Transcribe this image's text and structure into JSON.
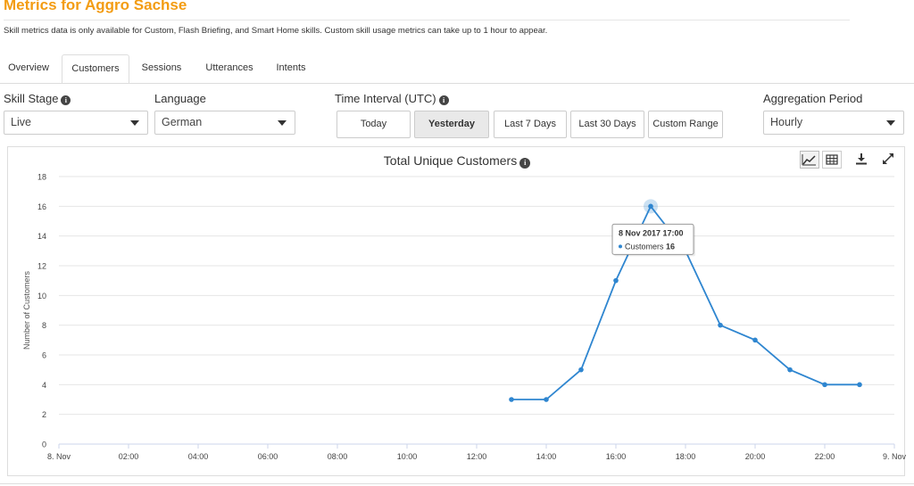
{
  "header": {
    "title": "Metrics for Aggro Sachse",
    "notice": "Skill metrics data is only available for Custom, Flash Briefing, and Smart Home skills. Custom skill usage metrics can take up to 1 hour to appear."
  },
  "tabs": [
    {
      "label": "Overview",
      "active": false
    },
    {
      "label": "Customers",
      "active": true
    },
    {
      "label": "Sessions",
      "active": false
    },
    {
      "label": "Utterances",
      "active": false
    },
    {
      "label": "Intents",
      "active": false
    }
  ],
  "controls": {
    "skill_stage": {
      "label": "Skill Stage",
      "value": "Live",
      "icon": "info-icon"
    },
    "language": {
      "label": "Language",
      "value": "German"
    },
    "time_interval": {
      "label": "Time Interval (UTC)",
      "icon": "info-icon",
      "options": [
        "Today",
        "Yesterday",
        "Last 7 Days",
        "Last 30 Days",
        "Custom Range"
      ],
      "selected": "Yesterday"
    },
    "aggregation_period": {
      "label": "Aggregation Period",
      "value": "Hourly"
    }
  },
  "chart_toolbar": {
    "icons": [
      "line-chart-icon",
      "table-icon",
      "download-icon",
      "expand-icon"
    ],
    "active": "line-chart-icon"
  },
  "chart_data": {
    "type": "line",
    "title": "Total Unique Customers",
    "ylabel": "Number of Customers",
    "xlabel": "",
    "ylim": [
      0,
      18
    ],
    "yticks": [
      0,
      2,
      4,
      6,
      8,
      10,
      12,
      14,
      16,
      18
    ],
    "xticks": [
      "8. Nov",
      "02:00",
      "04:00",
      "06:00",
      "08:00",
      "10:00",
      "12:00",
      "14:00",
      "16:00",
      "18:00",
      "20:00",
      "22:00",
      "9. Nov"
    ],
    "xtick_hours": [
      0,
      2,
      4,
      6,
      8,
      10,
      12,
      14,
      16,
      18,
      20,
      22,
      24
    ],
    "xlim_hours": [
      0,
      24
    ],
    "series": [
      {
        "name": "Customers",
        "color": "#2f86d0",
        "hours": [
          13,
          14,
          15,
          16,
          17,
          18,
          19,
          20,
          21,
          22,
          23
        ],
        "values": [
          3,
          3,
          5,
          11,
          16,
          13,
          8,
          7,
          5,
          4,
          4
        ]
      }
    ],
    "grid": true,
    "tooltip": {
      "date": "8 Nov 2017 17:00",
      "series": "Customers",
      "value": "16",
      "hour": 17
    }
  }
}
